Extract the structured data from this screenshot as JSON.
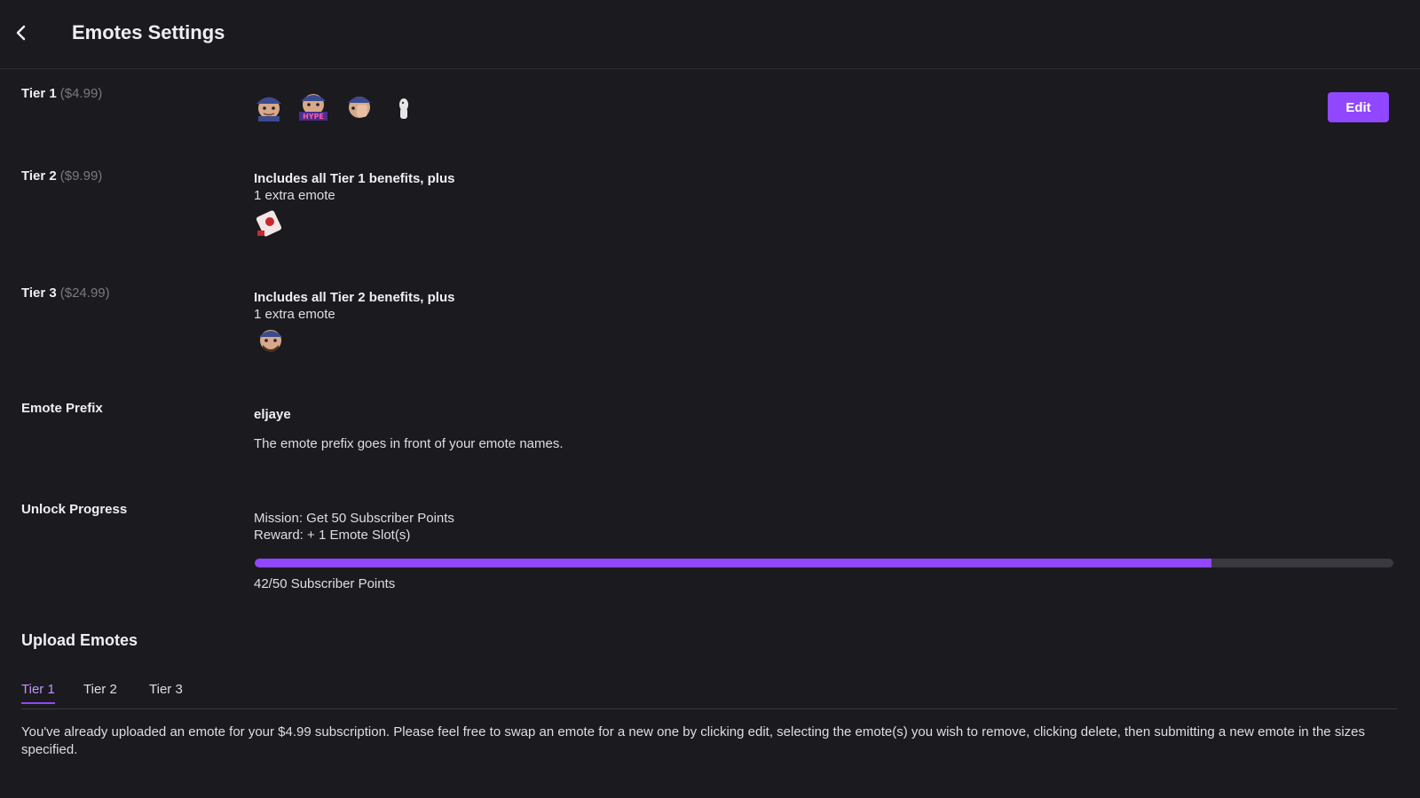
{
  "header": {
    "title": "Emotes Settings"
  },
  "tiers": [
    {
      "name": "Tier 1",
      "price": "($4.99)"
    },
    {
      "name": "Tier 2",
      "price": "($9.99)",
      "benefit_heading": "Includes all Tier 1 benefits, plus",
      "benefit_detail": "1 extra emote"
    },
    {
      "name": "Tier 3",
      "price": "($24.99)",
      "benefit_heading": "Includes all Tier 2 benefits, plus",
      "benefit_detail": "1 extra emote"
    }
  ],
  "edit_button": "Edit",
  "emote_prefix": {
    "label": "Emote Prefix",
    "value": "eljaye",
    "help": "The emote prefix goes in front of your emote names."
  },
  "unlock_progress": {
    "label": "Unlock Progress",
    "mission": "Mission: Get 50 Subscriber Points",
    "reward": "Reward: + 1 Emote Slot(s)",
    "current": 42,
    "goal": 50,
    "summary": "42/50 Subscriber Points"
  },
  "upload": {
    "title": "Upload Emotes",
    "tabs": [
      "Tier 1",
      "Tier 2",
      "Tier 3"
    ],
    "active_tab": "Tier 1",
    "notice": "You've already uploaded an emote for your $4.99 subscription. Please feel free to swap an emote for a new one by clicking edit, selecting the emote(s) you wish to remove, clicking delete, then submitting a new emote in the sizes specified."
  },
  "colors": {
    "accent": "#9147ff",
    "background": "#1b1a1e",
    "track": "#3a393f"
  }
}
